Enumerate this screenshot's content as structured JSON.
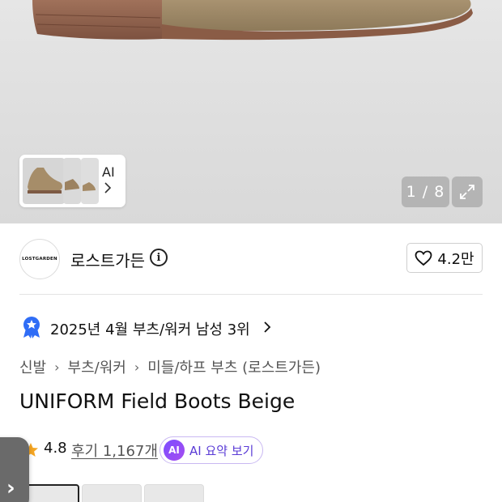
{
  "gallery": {
    "ai_label": "AI",
    "counter": "1 / 8",
    "icons": {
      "ai_chevron": "chevron-right-icon",
      "expand": "expand-icon"
    }
  },
  "brand": {
    "logo_text": "LOSTGARDEN",
    "name": "로스트가든",
    "info_icon": "info-icon",
    "like_count": "4.2만"
  },
  "ranking": {
    "text": "2025년 4월 부츠/워커 남성 3위",
    "chevron": "›",
    "badge_color": "#2f6df6"
  },
  "breadcrumb": {
    "items": [
      "신발",
      "부츠/워커",
      "미들/하프 부츠 (로스트가든)"
    ],
    "separator": "›"
  },
  "product": {
    "title": "UNIFORM Field Boots Beige"
  },
  "rating": {
    "score": "4.8",
    "reviews": "후기 1,167개",
    "star_color": "#f5a623",
    "ai_chip": "AI",
    "ai_summary": "AI 요약 보기"
  },
  "side_tab": {
    "chevron": "›"
  }
}
